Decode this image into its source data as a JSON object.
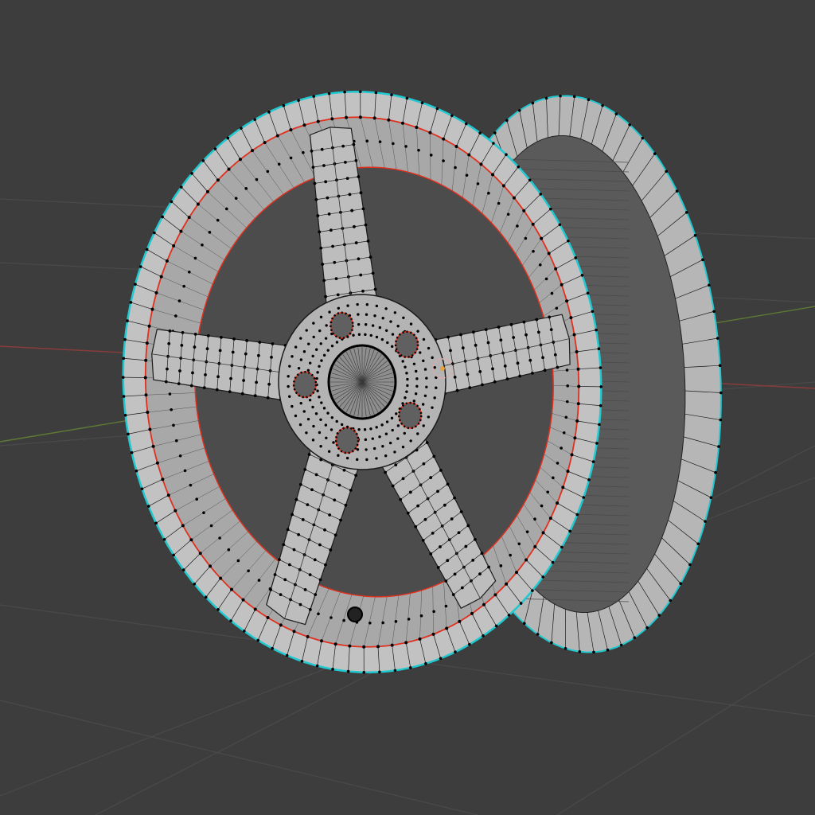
{
  "viewport": {
    "mode": "edit-mode-mesh",
    "object": "wheel-rim",
    "spoke_count": 5,
    "lug_hole_count": 5,
    "background_color": "#3d3d3d",
    "grid_color": "#4a4a4a",
    "x_axis_color": "#8a3c3c",
    "y_axis_color": "#5e7a34",
    "mesh_face_color": "#b9b9b9",
    "mesh_shadow_color": "#5a5a5a",
    "vertex_color": "#000000",
    "wire_color": "#1a1a1a",
    "seam_color": "#e0301e",
    "sharp_edge_color": "#20c8d0",
    "origin_color": "#e8a040"
  }
}
